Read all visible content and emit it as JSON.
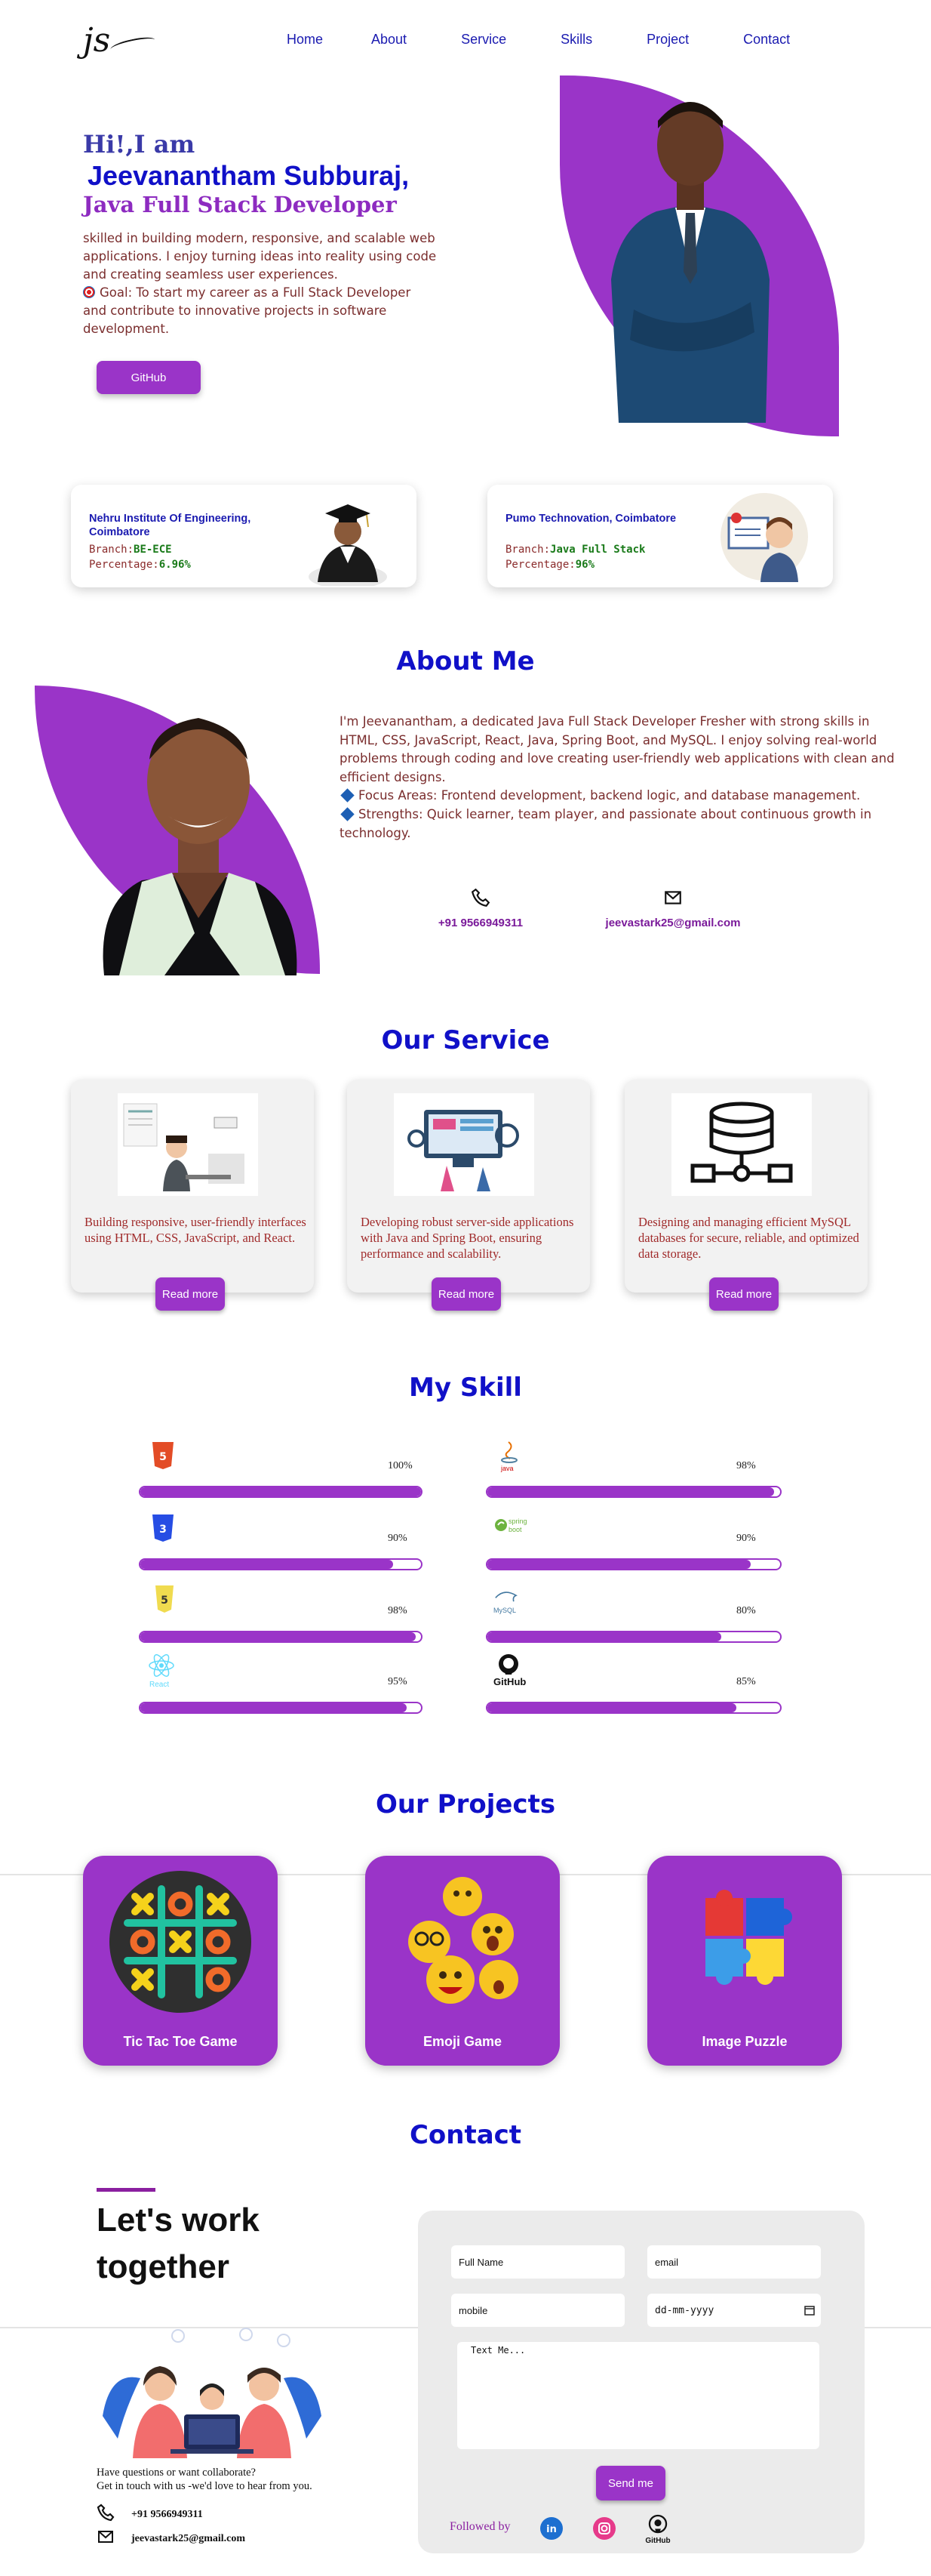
{
  "nav": {
    "logo": "js",
    "items": [
      "Home",
      "About",
      "Service",
      "Skills",
      "Project",
      "Contact"
    ]
  },
  "hero": {
    "greeting": "Hi!,I am",
    "name": "Jeevanantham Subburaj,",
    "role": "Java Full Stack Developer",
    "description": "skilled in building modern, responsive, and scalable web applications. I enjoy turning ideas into reality using code and creating seamless user experiences.",
    "goal": "Goal: To start my career as a Full Stack Developer and contribute to innovative projects in software development.",
    "github_button": "GitHub"
  },
  "education": [
    {
      "title": "Nehru Institute Of Engineering, Coimbatore",
      "branch_label": "Branch:",
      "branch": "BE-ECE",
      "pct_label": "Percentage:",
      "pct": "6.96%"
    },
    {
      "title": "Pumo Technovation, Coimbatore",
      "branch_label": "Branch:",
      "branch": "Java Full Stack",
      "pct_label": "Percentage:",
      "pct": "96%"
    }
  ],
  "about": {
    "heading": "About Me",
    "paragraph": "I'm Jeevanantham, a dedicated Java Full Stack Developer Fresher with strong skills in HTML, CSS, JavaScript, React, Java, Spring Boot, and MySQL. I enjoy solving real-world problems through coding and love creating user-friendly web applications with clean and efficient designs.",
    "focus": "Focus Areas: Frontend development, backend logic, and database management.",
    "strengths": "Strengths: Quick learner, team player, and passionate about continuous growth in technology.",
    "phone": "+91 9566949311",
    "email": "jeevastark25@gmail.com"
  },
  "services": {
    "heading": "Our Service",
    "items": [
      {
        "text": "Building responsive, user-friendly interfaces using HTML, CSS, JavaScript, and React.",
        "button": "Read more"
      },
      {
        "text": "Developing robust server-side applications with Java and Spring Boot, ensuring performance and scalability.",
        "button": "Read more"
      },
      {
        "text": "Designing and managing efficient MySQL databases for secure, reliable, and optimized data storage.",
        "button": "Read more"
      }
    ]
  },
  "skills": {
    "heading": "My Skill",
    "items": [
      {
        "name": "html5",
        "pct": "100%",
        "value": 100
      },
      {
        "name": "java",
        "pct": "98%",
        "value": 98,
        "label": "java"
      },
      {
        "name": "css3",
        "pct": "90%",
        "value": 90
      },
      {
        "name": "spring-boot",
        "pct": "90%",
        "value": 90,
        "label": "spring boot"
      },
      {
        "name": "javascript",
        "pct": "98%",
        "value": 98
      },
      {
        "name": "mysql",
        "pct": "80%",
        "value": 80,
        "label": "MySQL"
      },
      {
        "name": "react",
        "pct": "95%",
        "value": 95,
        "label": "React"
      },
      {
        "name": "github",
        "pct": "85%",
        "value": 85,
        "label": "GitHub"
      }
    ]
  },
  "projects": {
    "heading": "Our Projects",
    "items": [
      "Tic Tac Toe Game",
      "Emoji Game",
      "Image Puzzle"
    ]
  },
  "contact": {
    "heading": "Contact",
    "title": "Let's work together",
    "question": "Have questions or want collaborate?",
    "subtext": "Get in touch with us -we'd love to hear from you.",
    "phone": "+91 9566949311",
    "email": "jeevastark25@gmail.com",
    "form": {
      "fullname_placeholder": "Full Name",
      "email_placeholder": "email",
      "mobile_placeholder": "mobile",
      "date_placeholder": "dd-mm-yyyy",
      "message_placeholder": "Text Me...",
      "send_button": "Send me",
      "followed_by": "Followed by",
      "github_label": "GitHub"
    }
  },
  "colors": {
    "primary": "#9a34c8",
    "heading": "#1010c8",
    "body_text": "#7a2d2d"
  }
}
